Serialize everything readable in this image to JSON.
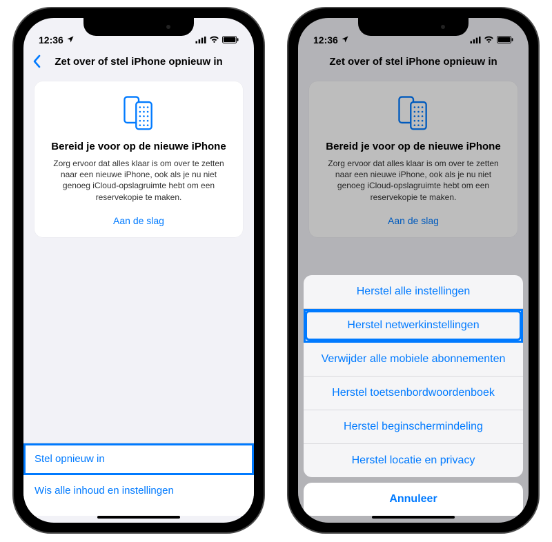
{
  "status": {
    "time": "12:36"
  },
  "nav": {
    "title": "Zet over of stel iPhone opnieuw in"
  },
  "card": {
    "title": "Bereid je voor op de nieuwe iPhone",
    "body": "Zorg ervoor dat alles klaar is om over te zetten naar een nieuwe iPhone, ook als je nu niet genoeg iCloud-opslagruimte hebt om een reservekopie te maken.",
    "link": "Aan de slag"
  },
  "bottom": {
    "reset": "Stel opnieuw in",
    "erase": "Wis alle inhoud en instellingen"
  },
  "sheet": {
    "items": [
      "Herstel alle instellingen",
      "Herstel netwerkinstellingen",
      "Verwijder alle mobiele abonnementen",
      "Herstel toetsenbordwoordenboek",
      "Herstel beginschermindeling",
      "Herstel locatie en privacy"
    ],
    "cancel": "Annuleer"
  }
}
